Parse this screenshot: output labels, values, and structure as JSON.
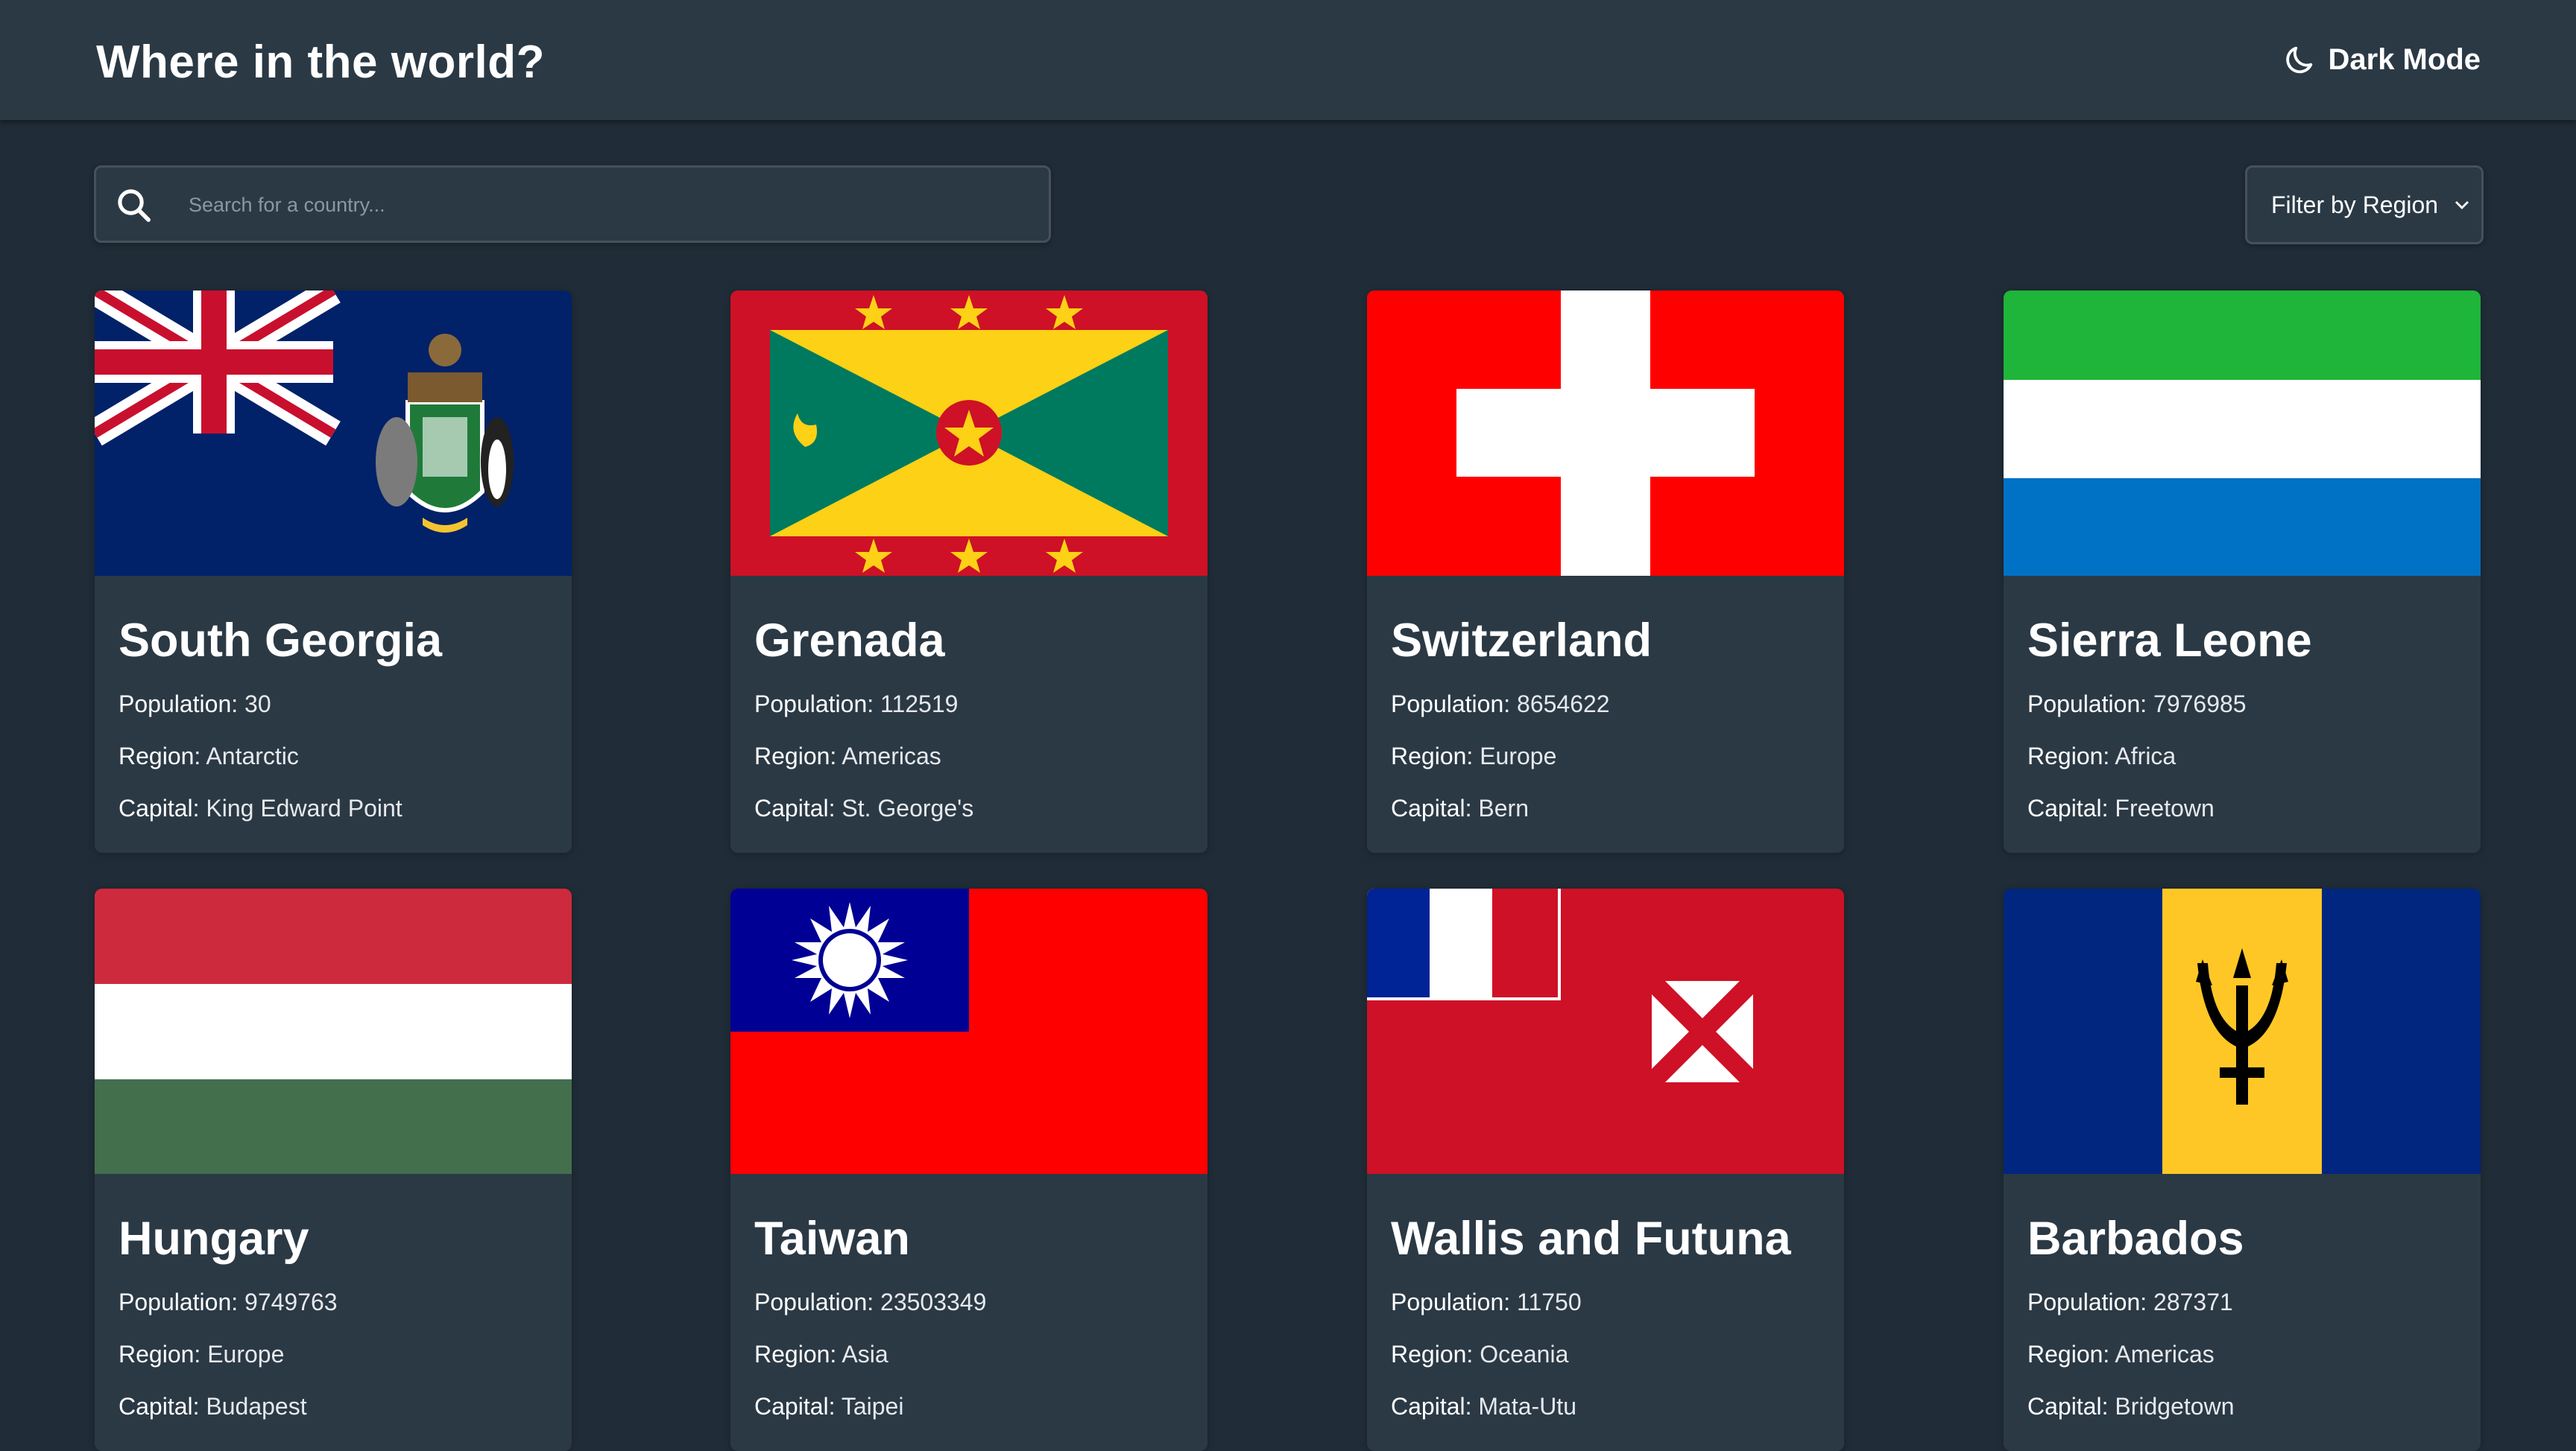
{
  "header": {
    "title": "Where in the world?",
    "mode_label": "Dark Mode"
  },
  "search": {
    "placeholder": "Search for a country..."
  },
  "filter": {
    "label": "Filter by Region"
  },
  "labels": {
    "population": "Population:",
    "region": "Region:",
    "capital": "Capital:"
  },
  "colors": {
    "background": "#202c37",
    "element": "#2b3945",
    "text": "#ffffff"
  },
  "countries": [
    {
      "name": "South Georgia",
      "population": "30",
      "region": "Antarctic",
      "capital": "King Edward Point",
      "flag": "south-georgia-flag"
    },
    {
      "name": "Grenada",
      "population": "112519",
      "region": "Americas",
      "capital": "St. George's",
      "flag": "grenada-flag"
    },
    {
      "name": "Switzerland",
      "population": "8654622",
      "region": "Europe",
      "capital": "Bern",
      "flag": "switzerland-flag"
    },
    {
      "name": "Sierra Leone",
      "population": "7976985",
      "region": "Africa",
      "capital": "Freetown",
      "flag": "sierra-leone-flag"
    },
    {
      "name": "Hungary",
      "population": "9749763",
      "region": "Europe",
      "capital": "Budapest",
      "flag": "hungary-flag"
    },
    {
      "name": "Taiwan",
      "population": "23503349",
      "region": "Asia",
      "capital": "Taipei",
      "flag": "taiwan-flag"
    },
    {
      "name": "Wallis and Futuna",
      "population": "11750",
      "region": "Oceania",
      "capital": "Mata-Utu",
      "flag": "wallis-futuna-flag"
    },
    {
      "name": "Barbados",
      "population": "287371",
      "region": "Americas",
      "capital": "Bridgetown",
      "flag": "barbados-flag"
    }
  ]
}
